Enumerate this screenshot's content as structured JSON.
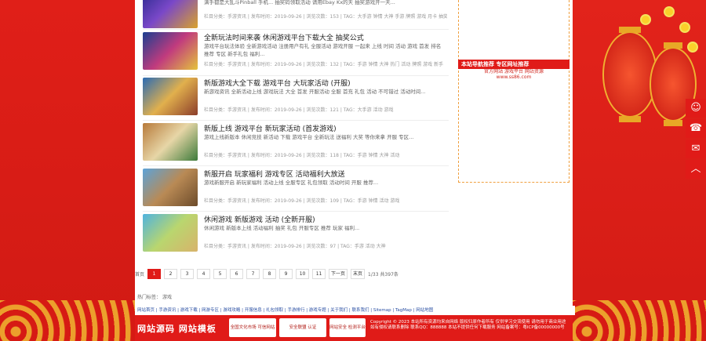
{
  "articles": [
    {
      "title": "",
      "desc": "满手都是大乱斗Pinball 手机... 抽奖码领取活动 请用Ebay Kx的天 抽奖游戏开一天...",
      "meta": "栏目分类：手游资讯 | 发布时间：2019-09-26 | 浏览次数：153 | TAG：大手游 钟情 大神 手游 牌照 游戏 月卡 抽奖 手游 新手 活动"
    },
    {
      "title": "全新玩法时间来袭 休闲游戏平台下载大全 抽奖公式",
      "desc": "游戏平台玩法体验 全新游戏活动 注册用户有礼 全服活动 游戏开服 一起来 上线 时间 活动 游戏 首发 排名 推荐 专区 新手礼包 福利...",
      "meta": "栏目分类：手游资讯 | 发布时间：2019-09-26 | 浏览次数：132 | TAG：手游 钟情 大神 热门 活动 牌照 游戏 新手"
    },
    {
      "title": "新版游戏大全下载 游戏平台 大玩家活动 (开服)",
      "desc": "新游戏资讯 全新活动上线 游戏玩法 大全 首发 开服活动 全服 首充 礼包 活动 不可错过 活动时间...",
      "meta": "栏目分类：手游资讯 | 发布时间：2019-09-26 | 浏览次数：121 | TAG：大手游 活动 游戏"
    },
    {
      "title": "新版上线 游戏平台 新玩家活动 (首发游戏)",
      "desc": "游戏上线新版本 休闲竞技 新活动 下载 游戏平台 全新玩法 送福利 大奖 等你来拿 开服 专区...",
      "meta": "栏目分类：手游资讯 | 发布时间：2019-09-26 | 浏览次数：118 | TAG：手游 钟情 大神 活动"
    },
    {
      "title": "新服开启 玩家福利 游戏专区 活动福利大放送",
      "desc": "游戏新服开启 新玩家福利 活动上线 全服专区 礼包领取 活动时间 开服 推荐...",
      "meta": "栏目分类：手游资讯 | 发布时间：2019-09-26 | 浏览次数：109 | TAG：手游 钟情 活动 游戏"
    },
    {
      "title": "休闲游戏 新版游戏 活动 (全新开服)",
      "desc": "休闲游戏 新版本上线 活动福利 抽奖 礼包 开服专区 推荐 玩家 福利...",
      "meta": "栏目分类：手游资讯 | 发布时间：2019-09-26 | 浏览次数：97 | TAG：手游 活动 大神"
    }
  ],
  "sidebar": {
    "box_title": "本站导航推荐 专区网址推荐",
    "box_sub_1": "官方网站 游戏平台 网站资源",
    "box_sub_2": "www.ss86.com"
  },
  "pager": {
    "first": "首页",
    "pages": [
      "1",
      "2",
      "3",
      "4",
      "5",
      "6",
      "7",
      "8",
      "9",
      "10",
      "11"
    ],
    "current": "1",
    "next": "下一页",
    "last": "末页",
    "summary": "1/33 共397条"
  },
  "tags": {
    "label": "热门标签：",
    "value": "游戏"
  },
  "linkbar": "网站首页 | 手游资讯 | 游戏下载 | 网游专区 | 游戏攻略 | 开服信息 | 礼包领取 | 手游排行 | 游戏专题 | 关于我们 | 联系我们 | Sitemap | TagMap | 网站地图",
  "footer": {
    "logo": "网站源码 网站模板",
    "badges": [
      "全国文化市场 可信网站",
      "安全联盟 认证",
      "网站安全 检测平台"
    ],
    "copyright": "Copyright © 2023 本站所有资源均来自网络 版权归原作者所有 仅供学习交流使用 请勿用于商业用途 如有侵权请联系删除 联系QQ：888888 本站不提供任何下载服务 网站备案号：粤ICP备00000000号"
  },
  "fixed": [
    "在线客服",
    "电话",
    "留言",
    "返回顶部"
  ],
  "colors": {
    "brand": "#e01b18",
    "page_bg": "#e8221b"
  }
}
